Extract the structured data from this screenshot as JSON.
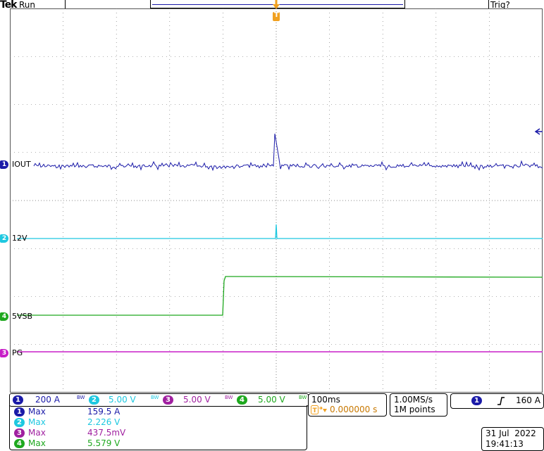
{
  "header": {
    "brand": "Tek",
    "run_status": "Run",
    "trigger_status": "Trig?"
  },
  "trigger_marker": {
    "letter": "T"
  },
  "channels": [
    {
      "id": "1",
      "name": "IOUT",
      "color": "#1a1aa8",
      "scale": "200 A"
    },
    {
      "id": "2",
      "name": "12V",
      "color": "#1ec8e0",
      "scale": "5.00 V"
    },
    {
      "id": "3",
      "name": "PG",
      "color": "#c81ec8",
      "scale": "5.00 V"
    },
    {
      "id": "4",
      "name": "5VSB",
      "color": "#1ea81e",
      "scale": "5.00 V"
    }
  ],
  "bw_mark": "BW",
  "measurements": [
    {
      "ch": "1",
      "type": "Max",
      "value": "159.5 A"
    },
    {
      "ch": "2",
      "type": "Max",
      "value": "2.226 V"
    },
    {
      "ch": "3",
      "type": "Max",
      "value": "437.5mV"
    },
    {
      "ch": "4",
      "type": "Max",
      "value": "5.579 V"
    }
  ],
  "timebase": {
    "scale": "100ms",
    "position": "0.000000 s"
  },
  "acquisition": {
    "sample_rate": "1.00MS/s",
    "record_length": "1M points"
  },
  "trigger": {
    "source": "1",
    "slope_icon": "rising-edge-icon",
    "level": "160 A"
  },
  "datetime": {
    "date": "31 Jul  2022",
    "time": "19:41:13"
  },
  "colors": {
    "trigger": "#f0a020",
    "grid": "#666666"
  }
}
